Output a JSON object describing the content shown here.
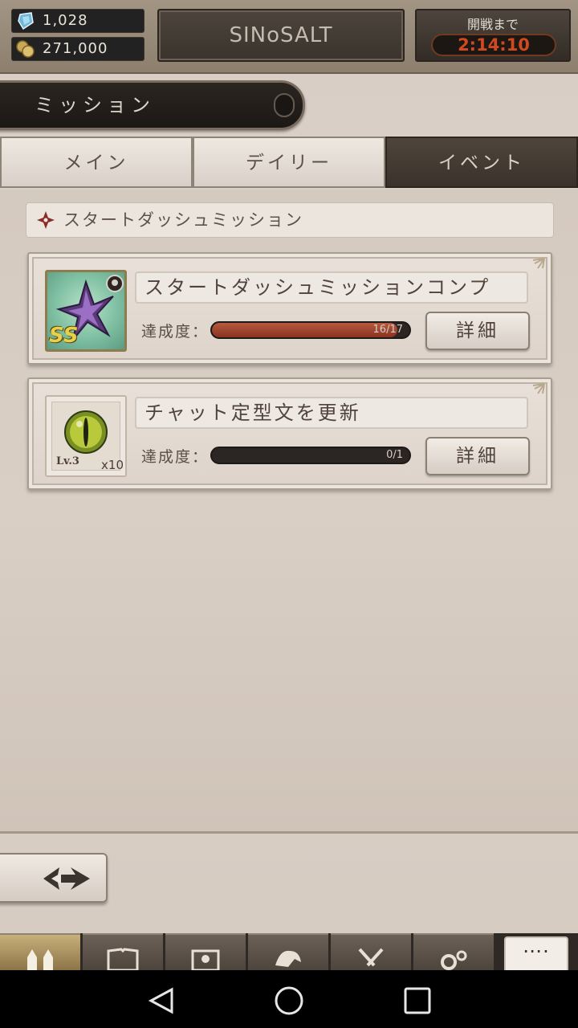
{
  "header": {
    "gems": "1,028",
    "coins": "271,000",
    "title": "SINoSALT",
    "timer_label": "開戦まで",
    "timer_value": "2:14:10"
  },
  "section": {
    "title": "ミッション"
  },
  "tabs": [
    {
      "label": "メイン",
      "active": false
    },
    {
      "label": "デイリー",
      "active": false
    },
    {
      "label": "イベント",
      "active": true
    }
  ],
  "subheader": {
    "label": "スタートダッシュミッション"
  },
  "missions": [
    {
      "title": "スタートダッシュミッションコンプ",
      "progress_label": "達成度：",
      "progress_text": "16/17",
      "progress_fraction": 0.94,
      "reward_rarity": "SS",
      "detail_label": "詳細"
    },
    {
      "title": "チャット定型文を更新",
      "progress_label": "達成度：",
      "progress_text": "0/1",
      "progress_fraction": 0.0,
      "reward_level": "Lv.3",
      "reward_qty": "x10",
      "detail_label": "詳細"
    }
  ],
  "nav": {
    "more_label": "…."
  },
  "colors": {
    "accent": "#d04a1e",
    "active_tab": "#3a322b",
    "bar_fill": "#8a3220"
  }
}
